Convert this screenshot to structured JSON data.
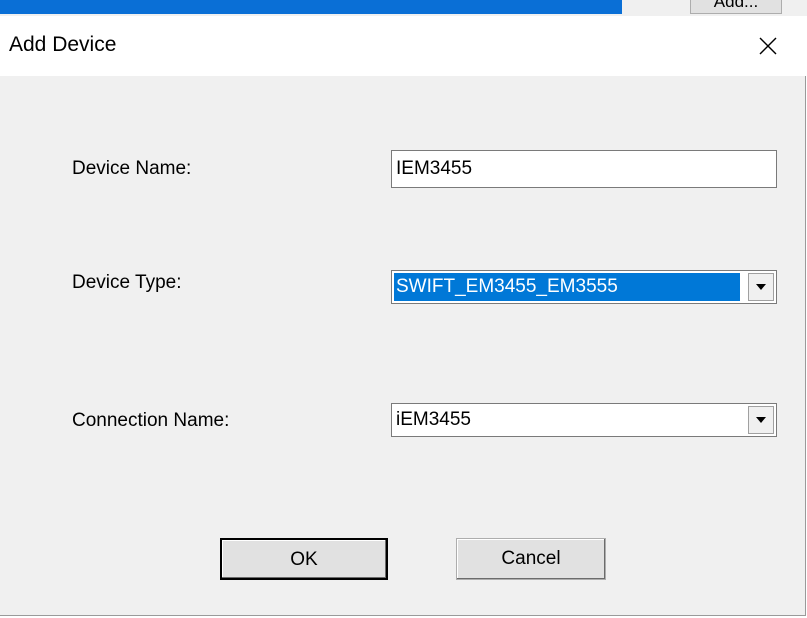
{
  "background_window": {
    "partial_button_label": "Add..."
  },
  "dialog": {
    "title": "Add Device",
    "close_glyph": "×",
    "fields": {
      "device_name": {
        "label": "Device Name:",
        "value": "IEM3455"
      },
      "device_type": {
        "label": "Device Type:",
        "value": "SWIFT_EM3455_EM3555"
      },
      "connection_name": {
        "label": "Connection Name:",
        "value": "iEM3455"
      }
    },
    "buttons": {
      "ok_label": "OK",
      "cancel_label": "Cancel"
    }
  },
  "colors": {
    "dialog_background": "#f0f0f0",
    "selection_highlight": "#0078d7"
  },
  "icons": {
    "close": "close-icon",
    "dropdown": "chevron-down-icon"
  }
}
